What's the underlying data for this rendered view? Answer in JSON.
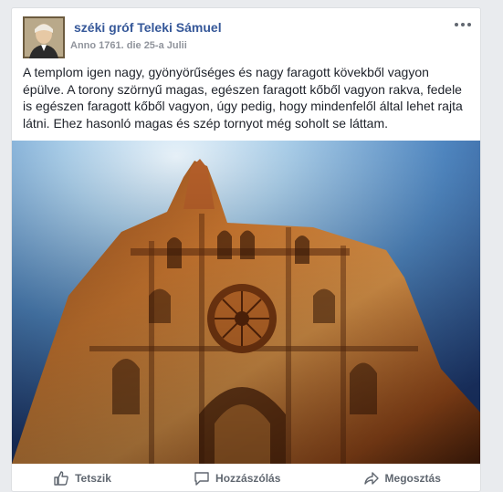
{
  "post": {
    "author": "széki gróf Teleki Sámuel",
    "date": "Anno 1761. die 25-a Julii",
    "text": "A templom igen nagy, gyönyörűséges és nagy faragott kövekből vagyon épülve. A torony szörnyű magas, egészen faragott kőből vagyon rakva, fedele is egészen faragott kőből vagyon, úgy pedig, hogy mindenfelől által lehet rajta látni. Ehez hasonló magas és szép tornyot még soholt se láttam."
  },
  "actions": {
    "like": "Tetszik",
    "comment": "Hozzászólás",
    "share": "Megosztás"
  },
  "icons": {
    "more": "more-options-icon",
    "like": "thumbs-up-icon",
    "comment": "speech-bubble-icon",
    "share": "share-arrow-icon"
  },
  "colors": {
    "author_link": "#365899",
    "meta_gray": "#90949c",
    "action_gray": "#606770",
    "page_bg": "#e9ebee"
  }
}
